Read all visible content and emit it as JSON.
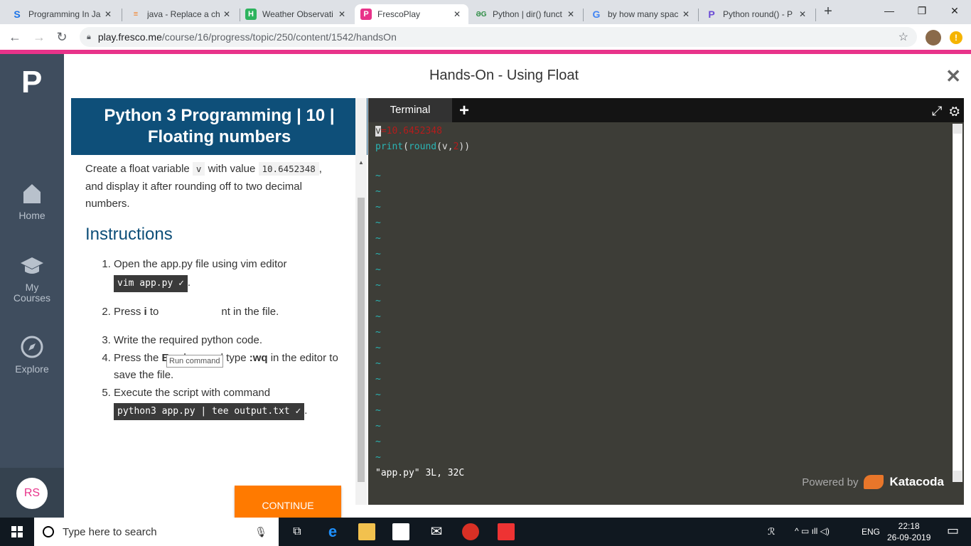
{
  "browser": {
    "tabs": [
      {
        "title": "Programming In Ja",
        "icon": "s-icon",
        "color": "#1a73e8"
      },
      {
        "title": "java - Replace a ch",
        "icon": "stackoverflow-icon",
        "color": "#f48024"
      },
      {
        "title": "Weather Observati",
        "icon": "h-icon",
        "color": "#2db35d"
      },
      {
        "title": "FrescoPlay",
        "icon": "p-icon",
        "color": "#e8338a"
      },
      {
        "title": "Python | dir() funct",
        "icon": "gfg-icon",
        "color": "#2f8d46"
      },
      {
        "title": "by how many spac",
        "icon": "google-icon",
        "color": "#4285f4"
      },
      {
        "title": "Python round() - P",
        "icon": "programiz-icon",
        "color": "#6b4bd6"
      }
    ],
    "url_host": "play.fresco.me",
    "url_path": "/course/16/progress/topic/250/content/1542/handsOn"
  },
  "sidebar": {
    "logo": "P",
    "items": [
      {
        "label": "Home"
      },
      {
        "label": "My Courses"
      },
      {
        "label": "Explore"
      }
    ],
    "user_initials": "RS"
  },
  "page": {
    "title": "Hands-On - Using Float",
    "card_title": "Python 3 Programming | 10 | Floating numbers",
    "intro_1": "Create a float variable",
    "intro_var": "v",
    "intro_2": "with value",
    "intro_value": "10.6452348",
    "intro_3": ", and display it after rounding off to two decimal numbers.",
    "instructions_heading": "Instructions",
    "step1_text": "Open the app.py file using vim editor",
    "step1_cmd": "vim app.py ✓",
    "step2_a": "Press",
    "step2_key": "i",
    "step2_b": "to",
    "step2_c": "nt in the file.",
    "tooltip": "Run command",
    "step3": "Write the required python code.",
    "step4_a": "Press the",
    "step4_key": "Esc",
    "step4_b": "key, and type",
    "step4_cmd": ":wq",
    "step4_c": "in the editor to save the file.",
    "step5_text": "Execute the script with command",
    "step5_cmd": "python3 app.py | tee output.txt ✓",
    "continue_label": "CONTINUE"
  },
  "terminal": {
    "tab_label": "Terminal",
    "line1_var": "v",
    "line1_eq": "=",
    "line1_val": "10.6452348",
    "line2_a": "print",
    "line2_b": "(",
    "line2_c": "round",
    "line2_d": "(v,",
    "line2_e": "2",
    "line2_f": "))",
    "status": "\"app.py\" 3L, 32C",
    "powered_by": "Powered by",
    "brand": "Katacoda",
    "tilde": "~"
  },
  "taskbar": {
    "search_placeholder": "Type here to search",
    "lang": "ENG",
    "time": "22:18",
    "date": "26-09-2019"
  }
}
